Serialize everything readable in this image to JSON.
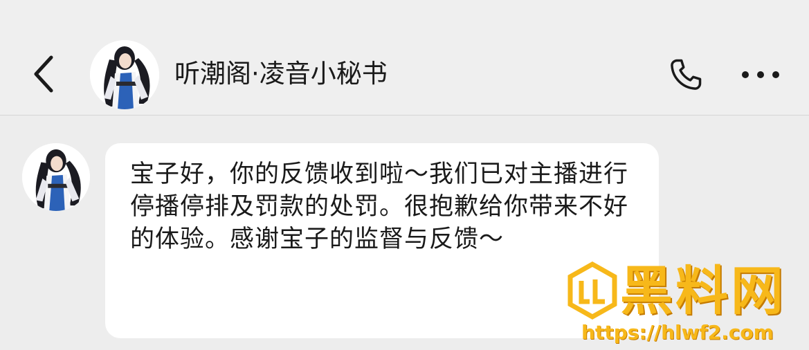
{
  "header": {
    "title": "听潮阁·凌音小秘书",
    "back_icon": "chevron-left-icon",
    "call_icon": "phone-icon",
    "more_icon": "more-dots-icon"
  },
  "conversation": {
    "messages": [
      {
        "sender": "incoming",
        "text": "宝子好，你的反馈收到啦～我们已对主播进行停播停排及罚款的处罚。很抱歉给你带来不好的体验。感谢宝子的监督与反馈～"
      }
    ]
  },
  "watermark": {
    "title": "黑料网",
    "url": "https://hlwf2.com",
    "color": "#f7b81a"
  },
  "colors": {
    "background": "#ededed",
    "bubble": "#ffffff",
    "text": "#1a1a1a"
  }
}
